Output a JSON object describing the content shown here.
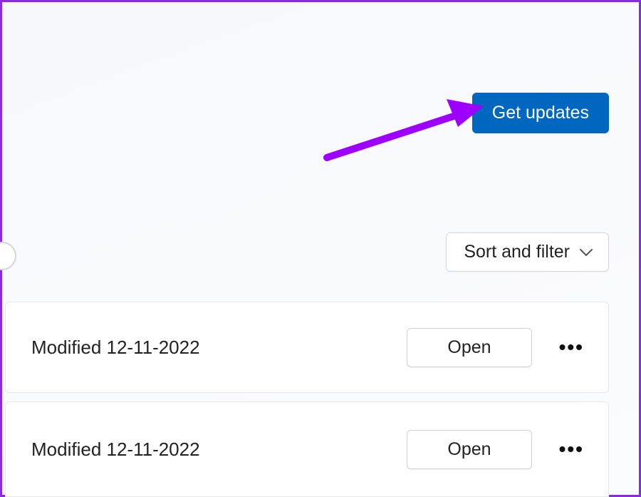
{
  "colors": {
    "accent": "#0067c0",
    "annotation": "#9d00ff",
    "frame_border": "#8a2be2"
  },
  "header": {
    "get_updates_label": "Get updates"
  },
  "toolbar": {
    "sort_filter_label": "Sort and filter"
  },
  "items": [
    {
      "modified_label": "Modified 12-11-2022",
      "open_label": "Open"
    },
    {
      "modified_label": "Modified 12-11-2022",
      "open_label": "Open"
    }
  ]
}
